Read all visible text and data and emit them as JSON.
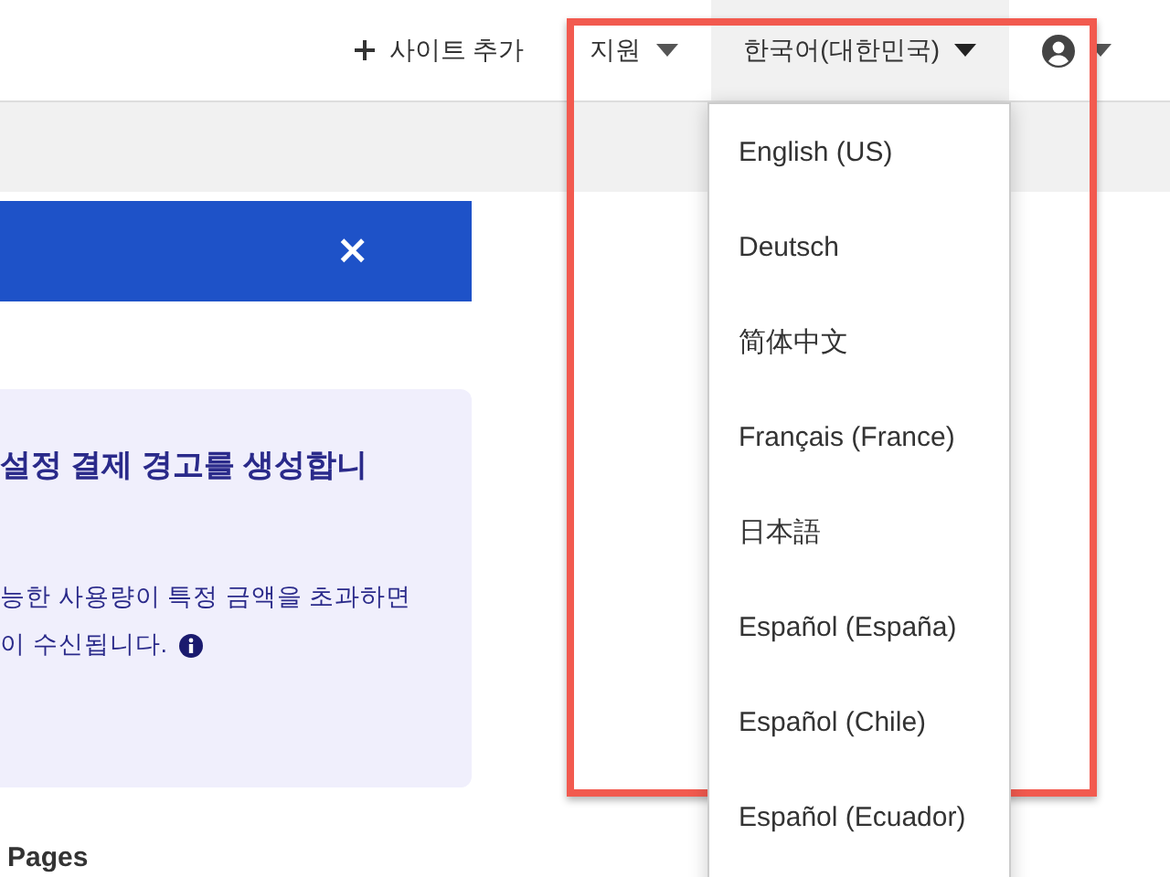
{
  "header": {
    "add_site": "사이트 추가",
    "support": "지원",
    "language": {
      "label": "한국어(대한민국)",
      "expanded": true
    }
  },
  "banner": {
    "close": "×"
  },
  "alert_card": {
    "title": "설정 결제 경고를 생성합니",
    "lines": [
      "능한 사용량이 특정 금액을 초과하면",
      "이 수신됩니다."
    ]
  },
  "section_heading": "Pages",
  "language_menu": [
    {
      "label": "English (US)"
    },
    {
      "label": "Deutsch"
    },
    {
      "label": "简体中文"
    },
    {
      "label": "Français (France)"
    },
    {
      "label": "日本語"
    },
    {
      "label": "Español (España)"
    },
    {
      "label": "Español (Chile)"
    },
    {
      "label": "Español (Ecuador)"
    }
  ]
}
